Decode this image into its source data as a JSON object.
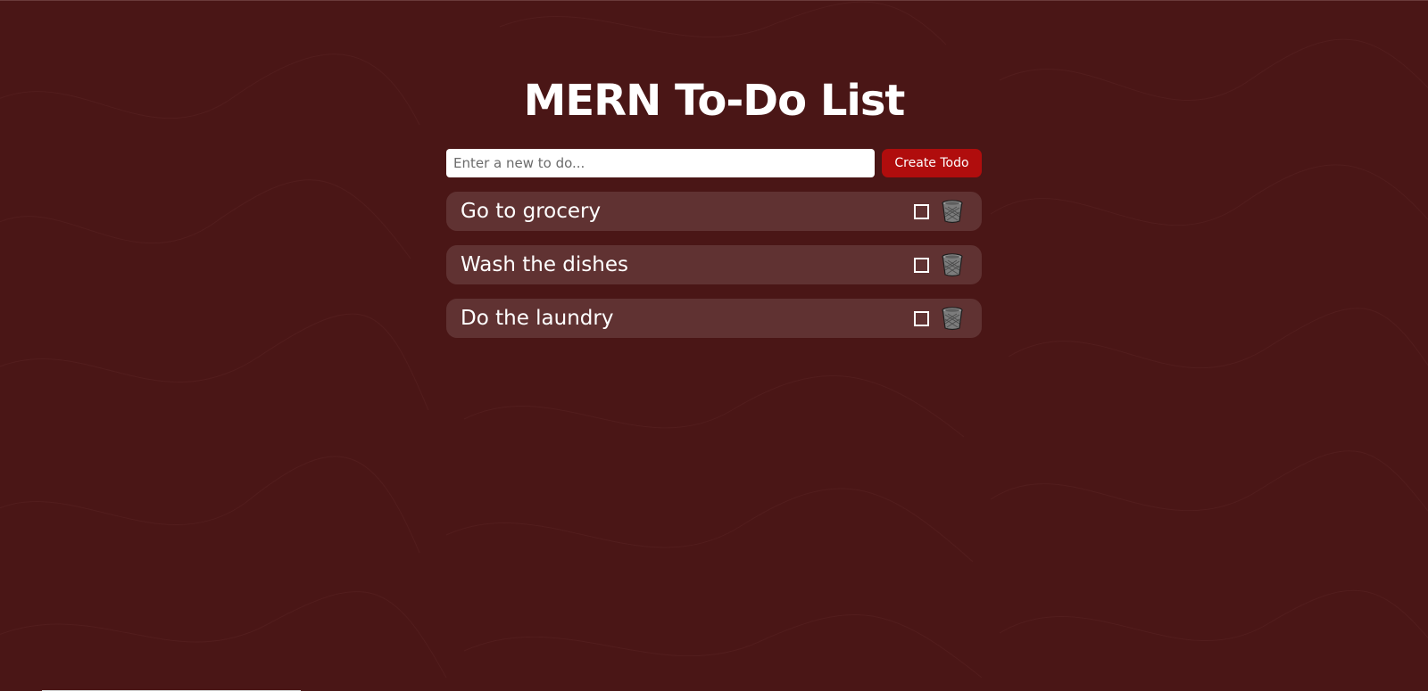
{
  "page": {
    "title": "MERN To-Do List",
    "background_color": "#4a1616"
  },
  "form": {
    "input_value": "",
    "input_placeholder": "Enter a new to do...",
    "create_label": "Create Todo",
    "button_color": "#b00d0d"
  },
  "todos": [
    {
      "text": "Go to grocery",
      "completed": false,
      "action_icon": "trash-icon"
    },
    {
      "text": "Wash the dishes",
      "completed": false,
      "action_icon": "trash-icon"
    },
    {
      "text": "Do the laundry",
      "completed": false,
      "action_icon": "trash-icon"
    }
  ]
}
